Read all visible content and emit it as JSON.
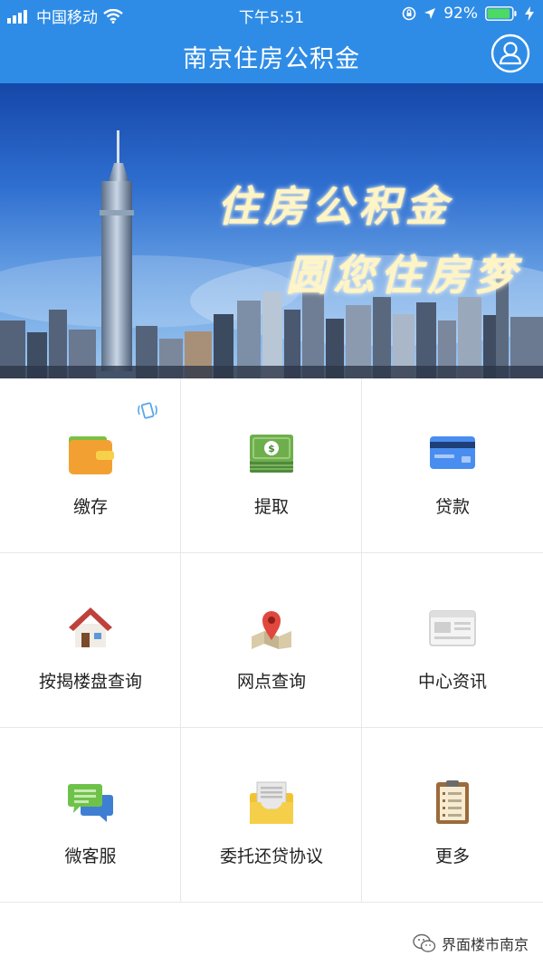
{
  "status_bar": {
    "carrier": "中国移动",
    "time": "下午5:51",
    "battery_percent": "92%",
    "battery_level": 0.92,
    "icons": [
      "signal-icon",
      "wifi-icon",
      "lock-rotation-icon",
      "location-icon",
      "battery-icon",
      "charging-icon"
    ]
  },
  "nav": {
    "title": "南京住房公积金",
    "user_icon": "user-avatar-icon"
  },
  "banner": {
    "line1": "住房公积金",
    "line2": "圆您住房梦"
  },
  "menu": {
    "items": [
      {
        "label": "缴存",
        "icon": "wallet-icon"
      },
      {
        "label": "提取",
        "icon": "cash-stack-icon"
      },
      {
        "label": "贷款",
        "icon": "bank-card-icon"
      },
      {
        "label": "按揭楼盘查询",
        "icon": "house-icon"
      },
      {
        "label": "网点查询",
        "icon": "map-pin-icon"
      },
      {
        "label": "中心资讯",
        "icon": "news-icon"
      },
      {
        "label": "微客服",
        "icon": "chat-bubbles-icon"
      },
      {
        "label": "委托还贷协议",
        "icon": "document-tray-icon"
      },
      {
        "label": "更多",
        "icon": "clipboard-icon"
      }
    ],
    "badge_icon": "vibrate-phone-icon"
  },
  "footer": {
    "watermark": "界面楼市南京",
    "icon": "wechat-icon"
  },
  "colors": {
    "primary": "#2f8ce6",
    "divider": "#e8e8e8",
    "text": "#222222"
  }
}
